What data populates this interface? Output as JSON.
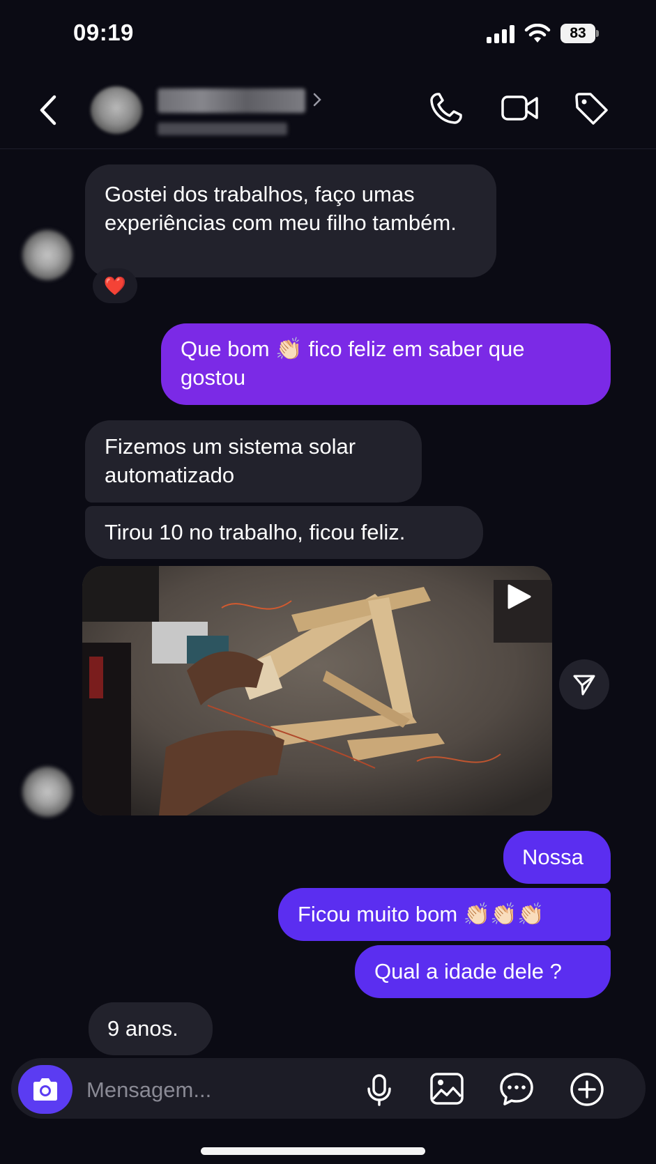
{
  "status_bar": {
    "time": "09:19",
    "battery": "83"
  },
  "header": {
    "back_icon": "chevron-left-icon",
    "actions": [
      "phone-icon",
      "video-camera-icon",
      "tag-icon"
    ]
  },
  "messages": {
    "m1": "Gostei dos trabalhos, faço umas experiências com meu filho também.",
    "m1_reaction": "❤️",
    "m2": "Que bom 👏🏻 fico feliz em saber que gostou",
    "m3": "Fizemos um sistema solar automatizado",
    "m4": "Tirou 10 no trabalho, ficou feliz.",
    "m5": "Nossa",
    "m6": "Ficou muito bom 👏🏻👏🏻👏🏻",
    "m7": "Qual a idade dele ?",
    "m8": "9 anos."
  },
  "composer": {
    "placeholder": "Mensagem..."
  },
  "colors": {
    "background": "#0b0b14",
    "incoming_bubble": "#22222c",
    "outgoing_bubble_purple": "#7b2ae6",
    "outgoing_bubble_indigo": "#5b2ef0",
    "camera_button": "#5b3cf2"
  }
}
